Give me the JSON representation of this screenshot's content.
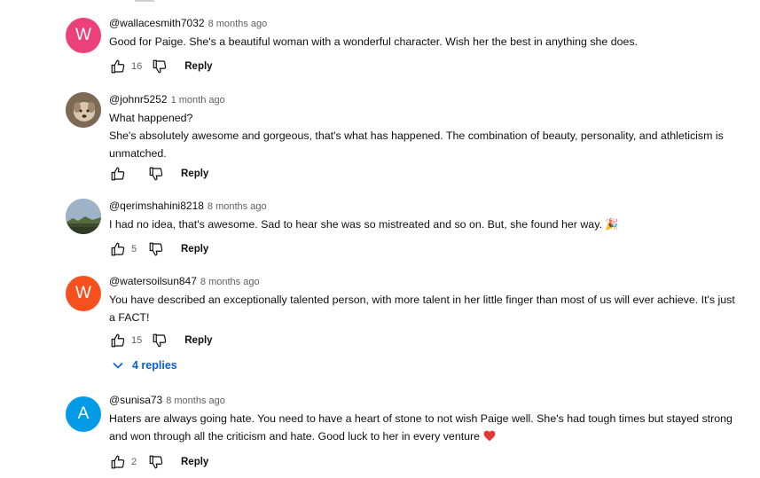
{
  "comments": [
    {
      "author": "@wallacesmith7032",
      "time": "8 months ago",
      "avatar_letter": "W",
      "avatar_color": "#ec407a",
      "lines": [
        "Good for Paige. She's a beautiful woman with a wonderful character. Wish her the best in anything she does."
      ],
      "likes": "16",
      "reply_label": "Reply"
    },
    {
      "author": "@johnr5252",
      "time": "1 month ago",
      "avatar_letter": "",
      "avatar_color": "#b9a58d",
      "lines": [
        "What happened?",
        "She's absolutely awesome and gorgeous, that's what has happened. The combination of beauty, personality, and athleticism is",
        "unmatched."
      ],
      "likes": "",
      "reply_label": "Reply"
    },
    {
      "author": "@qerimshahini8218",
      "time": "8 months ago",
      "avatar_letter": "",
      "avatar_color": "#7f98b5",
      "lines": [
        "I had no idea, that's awesome. Sad to hear she was so mistreated and so on. But, she found her way. 🎉"
      ],
      "likes": "5",
      "reply_label": "Reply"
    },
    {
      "author": "@watersoilsun847",
      "time": "8 months ago",
      "avatar_letter": "W",
      "avatar_color": "#f4511e",
      "lines": [
        "You have described an exceptionally talented person, with more talent in her little finger than most of us will ever achieve. It's just",
        "a FACT!"
      ],
      "likes": "15",
      "reply_label": "Reply"
    },
    {
      "author": "@sunisa73",
      "time": "8 months ago",
      "avatar_letter": "A",
      "avatar_color": "#039be5",
      "lines": [
        "Haters are always going hate. You need to have a heart of stone to not wish Paige well. She's had tough times but stayed strong",
        "and won through all the criticism and hate. Good luck to her in every venture"
      ],
      "likes": "2",
      "reply_label": "Reply"
    }
  ],
  "replies_toggle": {
    "label": "4 replies",
    "accent": "#065fd4"
  },
  "icons": {
    "like": "thumbs-up-icon",
    "dislike": "thumbs-down-icon",
    "expand": "chevron-down-icon",
    "heart": "heart-emoji-icon"
  }
}
